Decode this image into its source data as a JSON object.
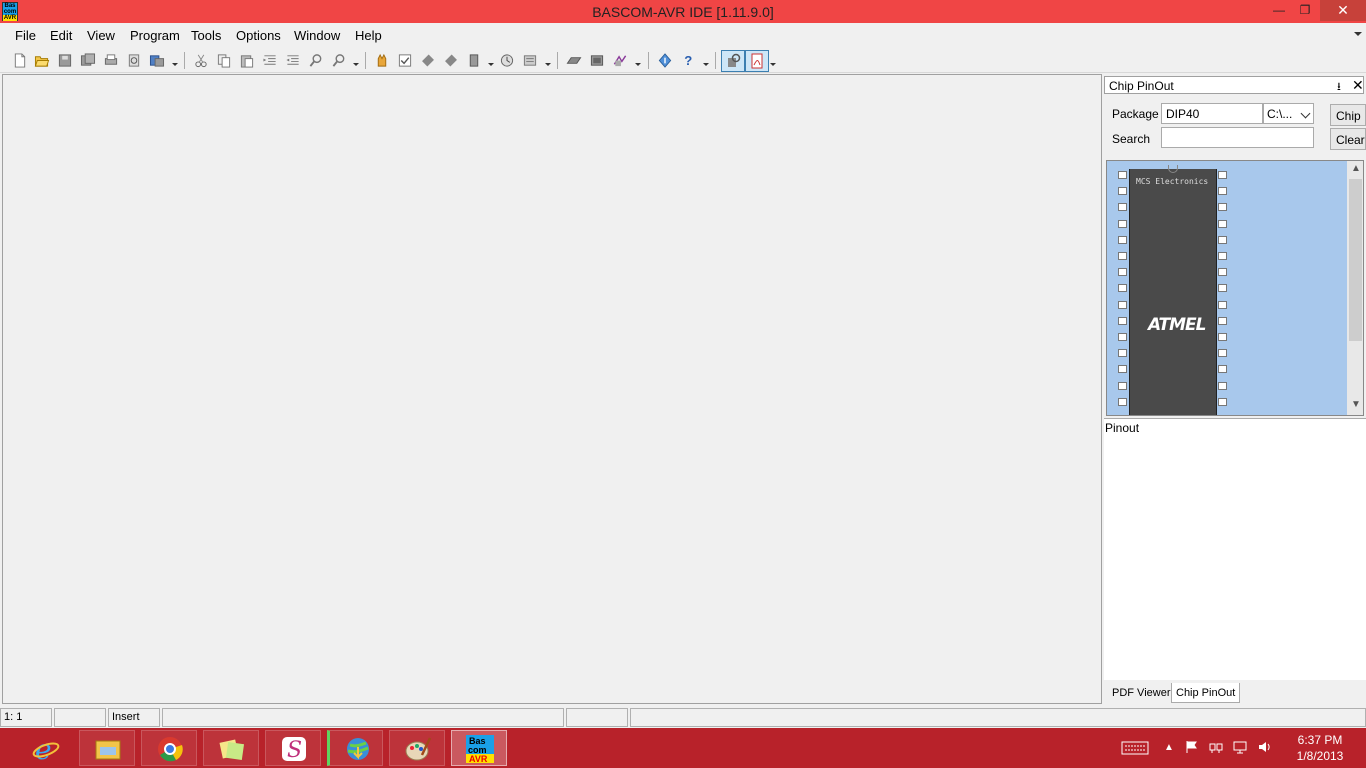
{
  "window": {
    "title": "BASCOM-AVR IDE [1.11.9.0]",
    "icon_lines": [
      "Bas",
      "com",
      "AVR"
    ],
    "min_label": "—",
    "max_label": "❐",
    "close_label": "✕"
  },
  "menu": [
    {
      "label": "File"
    },
    {
      "label": "Edit"
    },
    {
      "label": "View"
    },
    {
      "label": "Program"
    },
    {
      "label": "Tools"
    },
    {
      "label": "Options"
    },
    {
      "label": "Window"
    },
    {
      "label": "Help"
    }
  ],
  "toolbar_icons": [
    "new-file-icon",
    "open-folder-icon",
    "save-icon",
    "save-as-icon",
    "print-icon",
    "print-preview-icon",
    "send-icon",
    "cut-icon",
    "copy-icon",
    "paste-icon",
    "indent-icon",
    "unindent-icon",
    "find-icon",
    "find-next-icon",
    "compile-icon",
    "syntax-check-icon",
    "chip-icon",
    "chip2-icon",
    "program-icon",
    "simulate-icon",
    "report-icon",
    "lcd-icon",
    "terminal-icon",
    "designer-icon",
    "info-icon",
    "help-icon",
    "pinout-icon",
    "pdf-icon"
  ],
  "chip_pinout": {
    "title": "Chip PinOut",
    "pin_glyph": "⭳",
    "close_glyph": "✕",
    "package_label": "Package",
    "package_value": "DIP40",
    "path_value": "C:\\...",
    "chip_button": "Chip",
    "search_label": "Search",
    "search_value": "",
    "clear_button": "Clear",
    "chip_text": "MCS Electronics",
    "chip_logo": "ATMEL",
    "pinout_label": "Pinout",
    "tabs": [
      {
        "label": "PDF Viewer",
        "active": false
      },
      {
        "label": "Chip PinOut",
        "active": true
      }
    ]
  },
  "status": {
    "position": "1: 1",
    "mode": "Insert"
  },
  "taskbar": {
    "time": "6:37 PM",
    "date": "1/8/2013",
    "apps": [
      "internet-explorer-icon",
      "file-explorer-icon",
      "chrome-icon",
      "sticky-notes-icon",
      "app-s-icon",
      "internet-download-manager-icon",
      "paint-icon",
      "bascom-avr-icon"
    ]
  },
  "colors": {
    "title_bar": "#f04545",
    "taskbar": "#b8222a",
    "chip_background": "#a8c8ec"
  }
}
